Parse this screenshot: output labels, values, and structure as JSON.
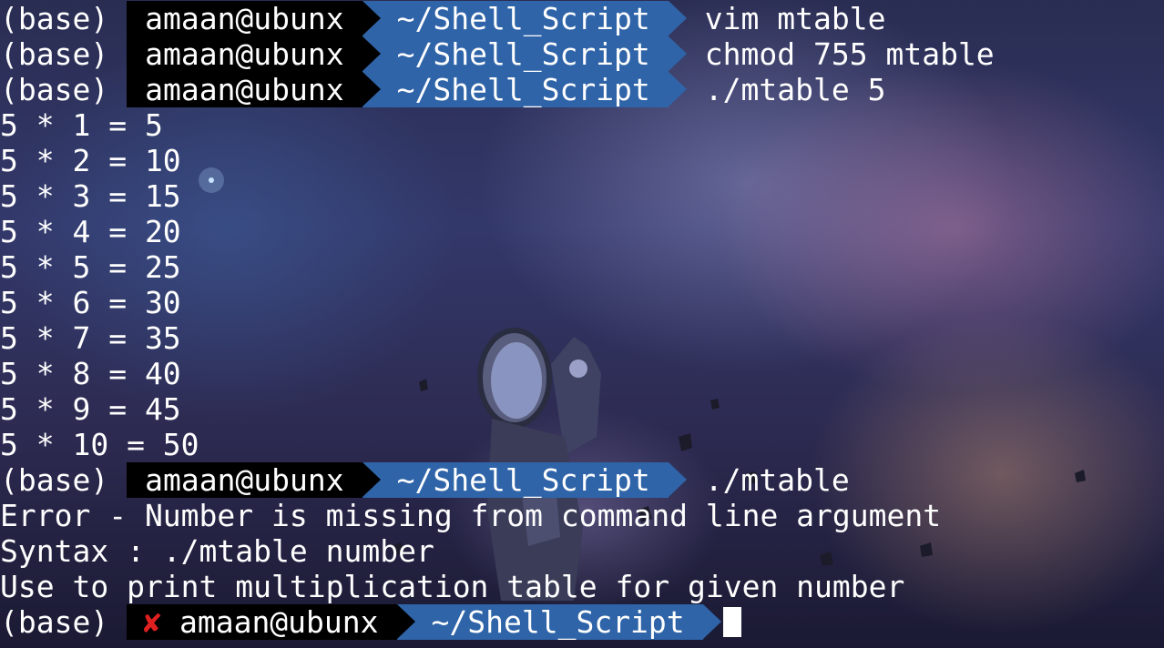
{
  "prompt": {
    "env": "(base)",
    "user": "amaan@ubunx",
    "dir": "~/Shell_Script",
    "fail_icon": "cross-icon"
  },
  "history": [
    {
      "command": "vim mtable"
    },
    {
      "command": "chmod 755 mtable"
    },
    {
      "command": "./mtable 5"
    }
  ],
  "output_table": [
    "5 * 1 = 5",
    "5 * 2 = 10",
    "5 * 3 = 15",
    "5 * 4 = 20",
    "5 * 5 = 25",
    "5 * 6 = 30",
    "5 * 7 = 35",
    "5 * 8 = 40",
    "5 * 9 = 45",
    "5 * 10 = 50"
  ],
  "second_command": "./mtable",
  "error_output": [
    "Error - Number is missing from command line argument",
    "Syntax : ./mtable number",
    "Use to print multiplication table for given number"
  ],
  "current_input": "",
  "colors": {
    "user_segment_bg": "#000000",
    "dir_segment_bg": "#2f64a8",
    "fail_mark": "#e02020",
    "text": "#ffffff"
  }
}
